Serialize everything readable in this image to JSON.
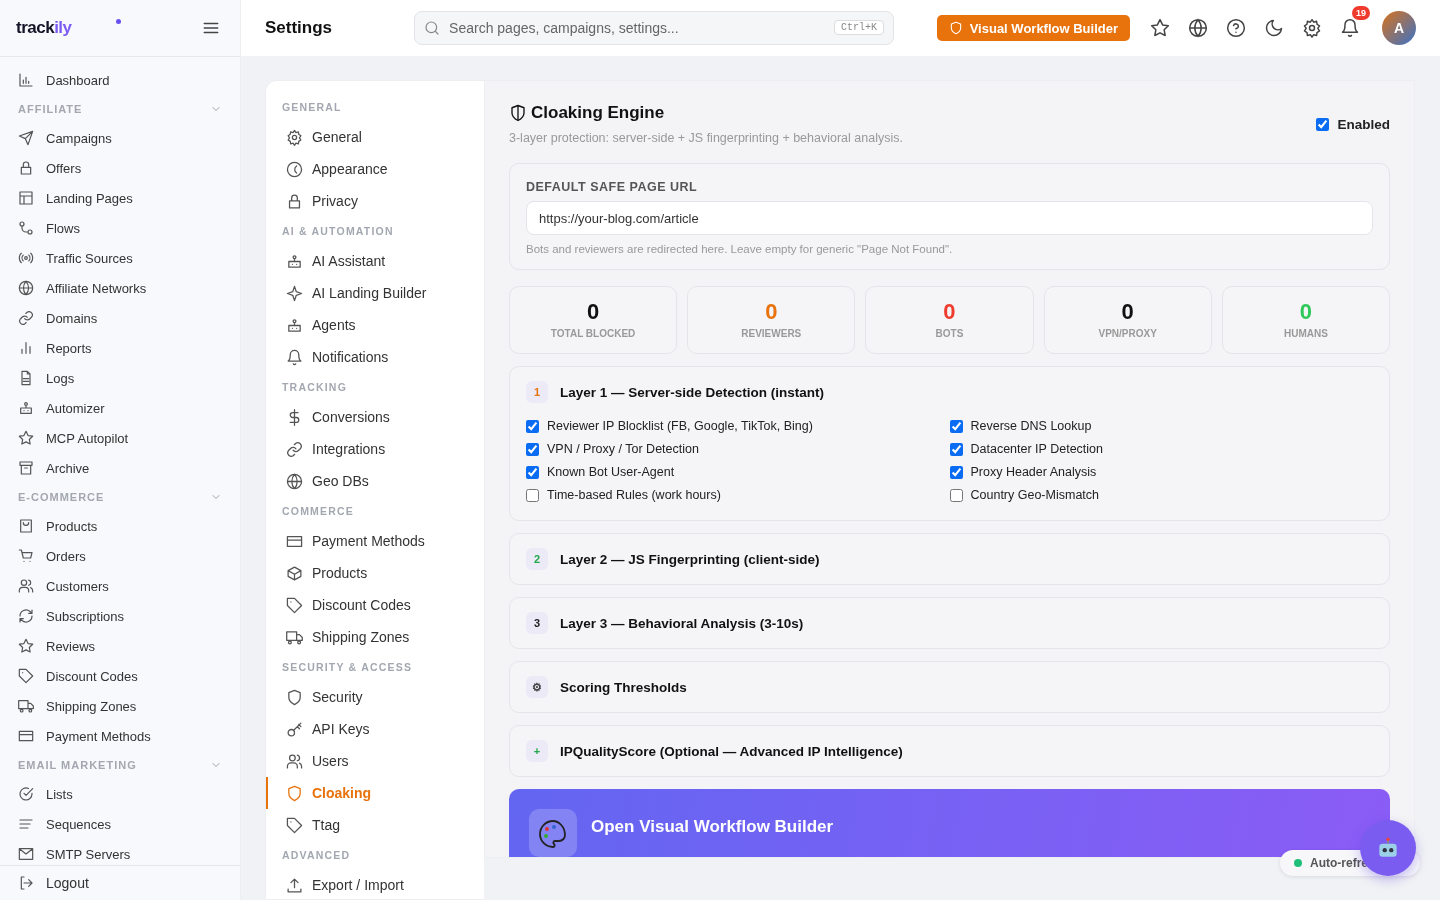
{
  "sidebar": {
    "logo": {
      "main": "track",
      "accent": "ily"
    },
    "top_items": [
      {
        "label": "Dashboard",
        "selected": false
      }
    ],
    "sections": [
      {
        "title": "AFFILIATE",
        "expanded": true,
        "items": [
          {
            "label": "Campaigns",
            "selected": false
          },
          {
            "label": "Offers",
            "selected": false
          },
          {
            "label": "Landing Pages",
            "selected": false
          },
          {
            "label": "Flows",
            "selected": false
          },
          {
            "label": "Traffic Sources",
            "selected": false
          },
          {
            "label": "Affiliate Networks",
            "selected": false
          },
          {
            "label": "Domains",
            "selected": false
          },
          {
            "label": "Reports",
            "selected": false
          },
          {
            "label": "Logs",
            "selected": false
          },
          {
            "label": "Automizer",
            "selected": false
          },
          {
            "label": "MCP Autopilot",
            "selected": false
          },
          {
            "label": "Archive",
            "selected": false
          }
        ]
      },
      {
        "title": "E-COMMERCE",
        "expanded": true,
        "items": [
          {
            "label": "Products",
            "selected": false
          },
          {
            "label": "Orders",
            "selected": false
          },
          {
            "label": "Customers",
            "selected": false
          },
          {
            "label": "Subscriptions",
            "selected": false
          },
          {
            "label": "Reviews",
            "selected": false
          },
          {
            "label": "Discount Codes",
            "selected": false
          },
          {
            "label": "Shipping Zones",
            "selected": false
          },
          {
            "label": "Payment Methods",
            "selected": false
          }
        ]
      },
      {
        "title": "EMAIL MARKETING",
        "expanded": true,
        "items": [
          {
            "label": "Lists",
            "selected": false
          },
          {
            "label": "Sequences",
            "selected": false
          },
          {
            "label": "SMTP Servers",
            "selected": false
          }
        ]
      }
    ],
    "logout": "Logout"
  },
  "header": {
    "title": "Settings",
    "search": {
      "placeholder": "Search pages, campaigns, settings...",
      "shortcut": "Ctrl+K"
    },
    "workflow_button": "Visual Workflow Builder",
    "notifications": "19",
    "avatar": "A"
  },
  "settings_nav": [
    {
      "title": "GENERAL",
      "items": [
        {
          "label": "General",
          "selected": false
        },
        {
          "label": "Appearance",
          "selected": false
        },
        {
          "label": "Privacy",
          "selected": false
        }
      ]
    },
    {
      "title": "AI & AUTOMATION",
      "items": [
        {
          "label": "AI Assistant",
          "selected": false
        },
        {
          "label": "AI Landing Builder",
          "selected": false
        },
        {
          "label": "Agents",
          "selected": false
        },
        {
          "label": "Notifications",
          "selected": false
        }
      ]
    },
    {
      "title": "TRACKING",
      "items": [
        {
          "label": "Conversions",
          "selected": false
        },
        {
          "label": "Integrations",
          "selected": false
        },
        {
          "label": "Geo DBs",
          "selected": false
        }
      ]
    },
    {
      "title": "COMMERCE",
      "items": [
        {
          "label": "Payment Methods",
          "selected": false
        },
        {
          "label": "Products",
          "selected": false
        },
        {
          "label": "Discount Codes",
          "selected": false
        },
        {
          "label": "Shipping Zones",
          "selected": false
        }
      ]
    },
    {
      "title": "SECURITY & ACCESS",
      "items": [
        {
          "label": "Security",
          "selected": false
        },
        {
          "label": "API Keys",
          "selected": false
        },
        {
          "label": "Users",
          "selected": false
        },
        {
          "label": "Cloaking",
          "selected": true
        },
        {
          "label": "Ttag",
          "selected": false
        }
      ]
    },
    {
      "title": "ADVANCED",
      "items": [
        {
          "label": "Export / Import",
          "selected": false
        }
      ]
    }
  ],
  "cloaking": {
    "title": "Cloaking Engine",
    "subtitle": "3-layer protection: server-side + JS fingerprinting + behavioral analysis.",
    "enabled": {
      "label": "Enabled",
      "checked": true
    },
    "safe_page": {
      "label": "DEFAULT SAFE PAGE URL",
      "value": "https://your-blog.com/article",
      "hint": "Bots and reviewers are redirected here. Leave empty for generic \"Page Not Found\"."
    },
    "stats": [
      {
        "value": "0",
        "label": "TOTAL BLOCKED",
        "color": "#111111"
      },
      {
        "value": "0",
        "label": "REVIEWERS",
        "color": "#e8720c"
      },
      {
        "value": "0",
        "label": "BOTS",
        "color": "#ef3b2d"
      },
      {
        "value": "0",
        "label": "VPN/PROXY",
        "color": "#111111"
      },
      {
        "value": "0",
        "label": "HUMANS",
        "color": "#2fc95a"
      }
    ],
    "layers": [
      {
        "badge": "1",
        "color": "#e8720c",
        "title": "Layer 1 — Server-side Detection (instant)",
        "expanded": true,
        "checks": [
          {
            "label": "Reviewer IP Blocklist (FB, Google, TikTok, Bing)",
            "checked": true
          },
          {
            "label": "Reverse DNS Lookup",
            "checked": true
          },
          {
            "label": "VPN / Proxy / Tor Detection",
            "checked": true
          },
          {
            "label": "Datacenter IP Detection",
            "checked": true
          },
          {
            "label": "Known Bot User-Agent",
            "checked": true
          },
          {
            "label": "Proxy Header Analysis",
            "checked": true
          },
          {
            "label": "Time-based Rules (work hours)",
            "checked": false
          },
          {
            "label": "Country Geo-Mismatch",
            "checked": false
          }
        ]
      },
      {
        "badge": "2",
        "color": "#22a84a",
        "title": "Layer 2 — JS Fingerprinting (client-side)"
      },
      {
        "badge": "3",
        "color": "#222222",
        "title": "Layer 3 — Behavioral Analysis (3-10s)"
      },
      {
        "badge": "⚙",
        "color": "#444444",
        "title": "Scoring Thresholds"
      },
      {
        "badge": "+",
        "color": "#22a84a",
        "title": "IPQualityScore (Optional — Advanced IP Intelligence)"
      }
    ],
    "banner": {
      "title": "Open Visual Workflow Builder"
    }
  },
  "status": {
    "label": "Auto-refre",
    "on": true
  }
}
